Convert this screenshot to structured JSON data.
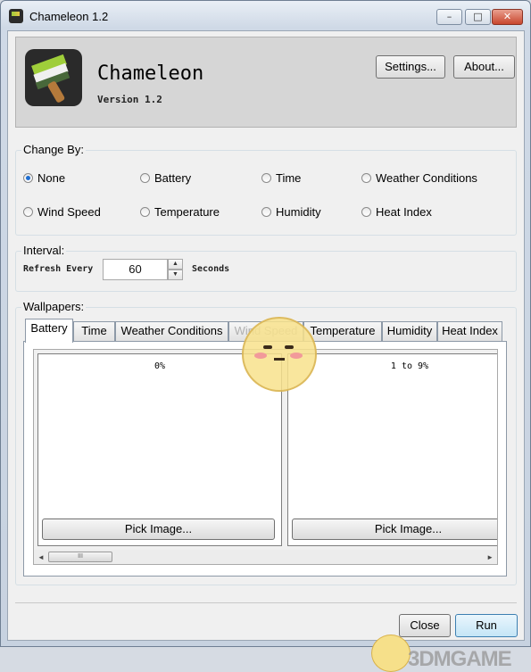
{
  "window": {
    "title": "Chameleon 1.2",
    "min_glyph": "–",
    "max_glyph": "□",
    "close_glyph": "✕"
  },
  "header": {
    "app_name": "Chameleon",
    "version": "Version 1.2",
    "settings_label": "Settings...",
    "about_label": "About..."
  },
  "change_by": {
    "label": "Change By:",
    "options": [
      "None",
      "Battery",
      "Time",
      "Weather Conditions",
      "Wind Speed",
      "Temperature",
      "Humidity",
      "Heat Index"
    ],
    "selected": "None"
  },
  "interval": {
    "label": "Interval:",
    "refresh_label": "Refresh Every",
    "value": "60",
    "unit": "Seconds",
    "up_glyph": "▲",
    "down_glyph": "▼"
  },
  "wallpapers": {
    "label": "Wallpapers:",
    "tabs": [
      "Battery",
      "Time",
      "Weather Conditions",
      "Wind Speed",
      "Temperature",
      "Humidity",
      "Heat Index"
    ],
    "active_tab": "Battery",
    "cards": [
      {
        "label": "0%",
        "button": "Pick Image..."
      },
      {
        "label": "1 to 9%",
        "button": "Pick Image..."
      }
    ],
    "scroll_left": "◄",
    "scroll_right": "►",
    "thumb_grip": "III"
  },
  "footer": {
    "close_label": "Close",
    "run_label": "Run"
  },
  "watermark": "3DMGAME",
  "colors": {
    "accent": "#1e6ed1",
    "window_frame": "#c7d2e0",
    "client_bg": "#f0f0f0"
  }
}
